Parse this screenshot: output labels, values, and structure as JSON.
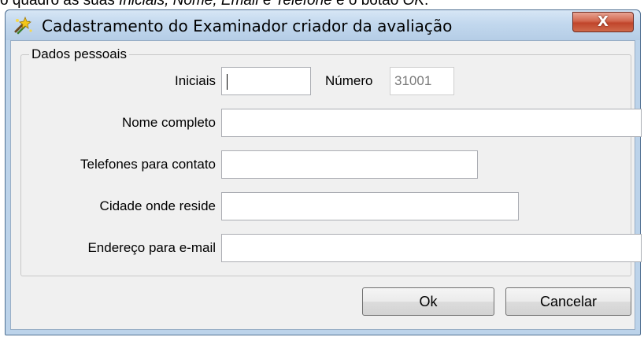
{
  "caption": {
    "prefix": "o quadro as suas ",
    "italic_fields": "Iniciais, Nome, Email",
    "mid": " e ",
    "italic_phone": "Telefone",
    "suffix": " e o botão ",
    "italic_ok": "OK",
    "end": "."
  },
  "window": {
    "title": "Cadastramento do Examinador criador da avaliação",
    "close_glyph": "X",
    "icon": "sparkle-tool-icon"
  },
  "group": {
    "label": "Dados pessoais"
  },
  "fields": {
    "iniciais": {
      "label": "Iniciais",
      "value": ""
    },
    "numero": {
      "label": "Número",
      "value": "31001"
    },
    "nome": {
      "label": "Nome completo",
      "value": ""
    },
    "telefones": {
      "label": "Telefones para contato",
      "value": ""
    },
    "cidade": {
      "label": "Cidade onde reside",
      "value": ""
    },
    "email": {
      "label": "Endereço para e-mail",
      "value": ""
    }
  },
  "buttons": {
    "ok": "Ok",
    "cancel": "Cancelar"
  },
  "colors": {
    "title_bar": "#c2d8ee",
    "close_button": "#c0452b",
    "dialog_face": "#f0f0f0"
  }
}
